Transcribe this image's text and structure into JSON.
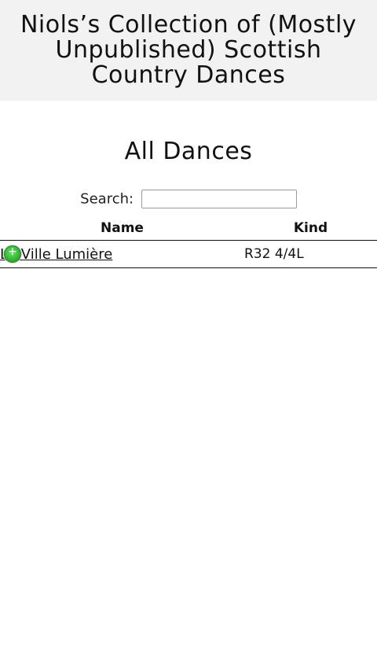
{
  "header": {
    "site_title": "Niols’s Collection of (Mostly Unpublished) Scottish Country Dances"
  },
  "main": {
    "heading": "All Dances",
    "search": {
      "label": "Search:",
      "value": "",
      "placeholder": ""
    },
    "table": {
      "columns": [
        "Name",
        "Kind"
      ],
      "rows": [
        {
          "name": "La Ville Lumière",
          "kind": "R32 4/4L"
        }
      ]
    }
  },
  "colors": {
    "header_background": "#f2f2f2",
    "expand_icon": "#2fb52f"
  },
  "icons": {
    "row_expand": "plus-circle-icon"
  }
}
